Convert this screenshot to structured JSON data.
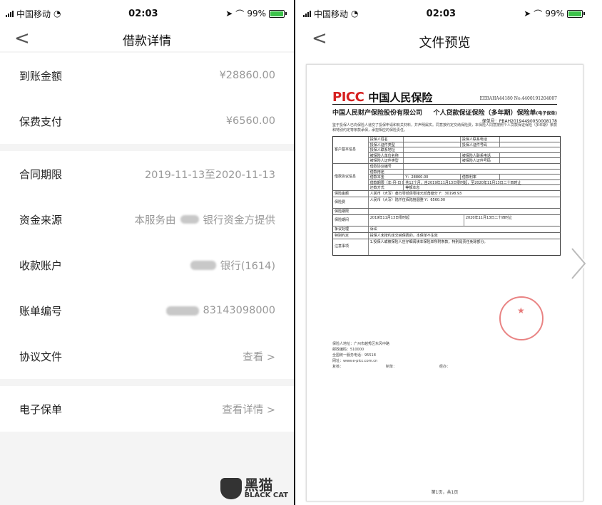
{
  "left": {
    "status": {
      "carrier": "中国移动",
      "time": "02:03",
      "battery": "99%"
    },
    "nav": {
      "title": "借款详情",
      "back_glyph": "<"
    },
    "groups": [
      [
        {
          "key": "到账金额",
          "value": "¥28860.00"
        },
        {
          "key": "保费支付",
          "value": "¥6560.00"
        }
      ],
      [
        {
          "key": "合同期限",
          "value": "2019-11-13至2020-11-13"
        },
        {
          "key": "资金来源",
          "value_pre": "本服务由",
          "value_post": "银行资金方提供"
        },
        {
          "key": "收款账户",
          "value_post": "银行(1614)"
        },
        {
          "key": "账单编号",
          "value_post": "83143098000"
        },
        {
          "key": "协议文件",
          "value": "查看 >"
        }
      ],
      [
        {
          "key": "电子保单",
          "value": "查看详情 >"
        }
      ]
    ],
    "watermark": {
      "cn": "黑猫",
      "en": "BLACK CAT"
    }
  },
  "right": {
    "status": {
      "carrier": "中国移动",
      "time": "02:03",
      "battery": "99%"
    },
    "nav": {
      "title": "文件预览",
      "back_glyph": "<"
    },
    "doc": {
      "logo": "PICC",
      "company_short": "中国人民保险",
      "code": "EEBAHA44180     No.4400191204007",
      "company_full": "中国人民财产保险股份有限公司",
      "doc_type": "个人贷款保证保险（多年期）保险单",
      "doc_tag": "(电子保单)",
      "policy_label": "保单号：PBAH20194490050008178",
      "intro": "鉴于投保人已向保险人递交了投保申请和有关材料，并声明属实。同意按约定交纳保险费，本保险人同意按照个人贷款保证保险（多年期）条款和特别约定等条款承保，承担相应的保险责任。",
      "table_sections": [
        "客户基本信息",
        "借款协议信息",
        "保险金额",
        "保险费",
        "保险期限",
        "保险期间",
        "争议处理",
        "特别约定",
        "注意事项"
      ],
      "row_labels": [
        "投保人姓名",
        "投保人证件类型",
        "投保人联系地址",
        "被保险人单位名称",
        "被保险人证件类型",
        "被保险人联系地址",
        "借款协议编号",
        "借款用途",
        "借款本金",
        "借款期限（年-月-日 时间）",
        "还款方式"
      ],
      "right_labels": [
        "投保人联系电话",
        "投保人证件号码",
        "被保险人联系电话",
        "被保险人证件号码",
        "借款利率"
      ],
      "values": [
        "Y：28860.00",
        "共12个月，自2019年11月13日零时起，至2020年11月13日二十四时止",
        "等额本息",
        "人民币（大写）叁万零贰佰零拾元贰角叁分 Y：30198.93",
        "人民币（大写）陆仟伍佰陆拾圆整 Y：6560.00",
        "2019年11月13日零时起",
        "2020年11月13日二十四时止",
        "诉讼",
        "投保人未按约定交纳保费的，本保单不生效",
        "1.投保人或被保险人应仔细阅读本保险单所附条款，特别是责任免除部分。"
      ],
      "footer": [
        "保险人地址：广州市越秀区东风中路",
        "邮政编码：510000",
        "全国统一服务电话：95518",
        "网址：www.e-picc.com.cn",
        "复核：",
        "制单：",
        "经办："
      ],
      "page": "第1页，共1页"
    }
  }
}
